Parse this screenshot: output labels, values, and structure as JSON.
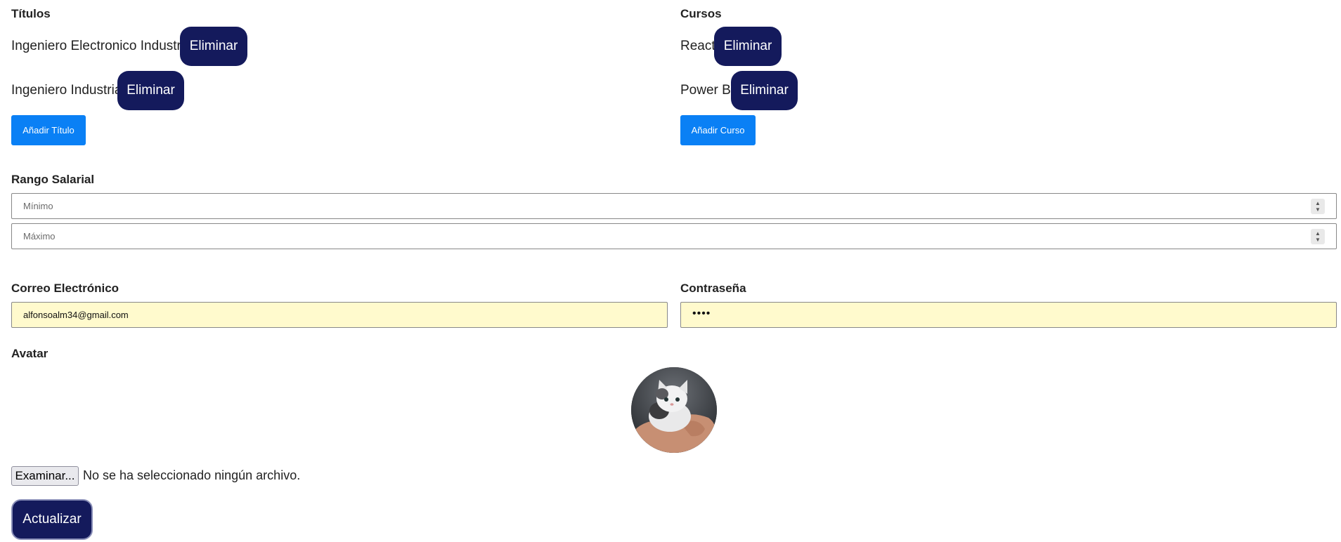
{
  "titulos": {
    "heading": "Títulos",
    "items": [
      {
        "label": "Ingeniero Electronico Industrial",
        "delete_label": "Eliminar"
      },
      {
        "label": "Ingeniero Industrial",
        "delete_label": "Eliminar"
      }
    ],
    "add_label": "Añadir Título"
  },
  "cursos": {
    "heading": "Cursos",
    "items": [
      {
        "label": "React",
        "delete_label": "Eliminar"
      },
      {
        "label": "Power Bi",
        "delete_label": "Eliminar"
      }
    ],
    "add_label": "Añadir Curso"
  },
  "salario": {
    "heading": "Rango Salarial",
    "min_placeholder": "Mínimo",
    "max_placeholder": "Máximo"
  },
  "correo": {
    "heading": "Correo Electrónico",
    "value": "alfonsoalm34@gmail.com"
  },
  "contrasena": {
    "heading": "Contraseña",
    "masked_value": "••••"
  },
  "avatar": {
    "heading": "Avatar",
    "image": "kitten-in-hand-photo"
  },
  "file": {
    "button_label": "Examinar...",
    "status": "No se ha seleccionado ningún archivo."
  },
  "submit_label": "Actualizar",
  "colors": {
    "dark_button": "#141a5c",
    "blue_button": "#0a80f5",
    "autofill_bg": "#fffacd"
  }
}
